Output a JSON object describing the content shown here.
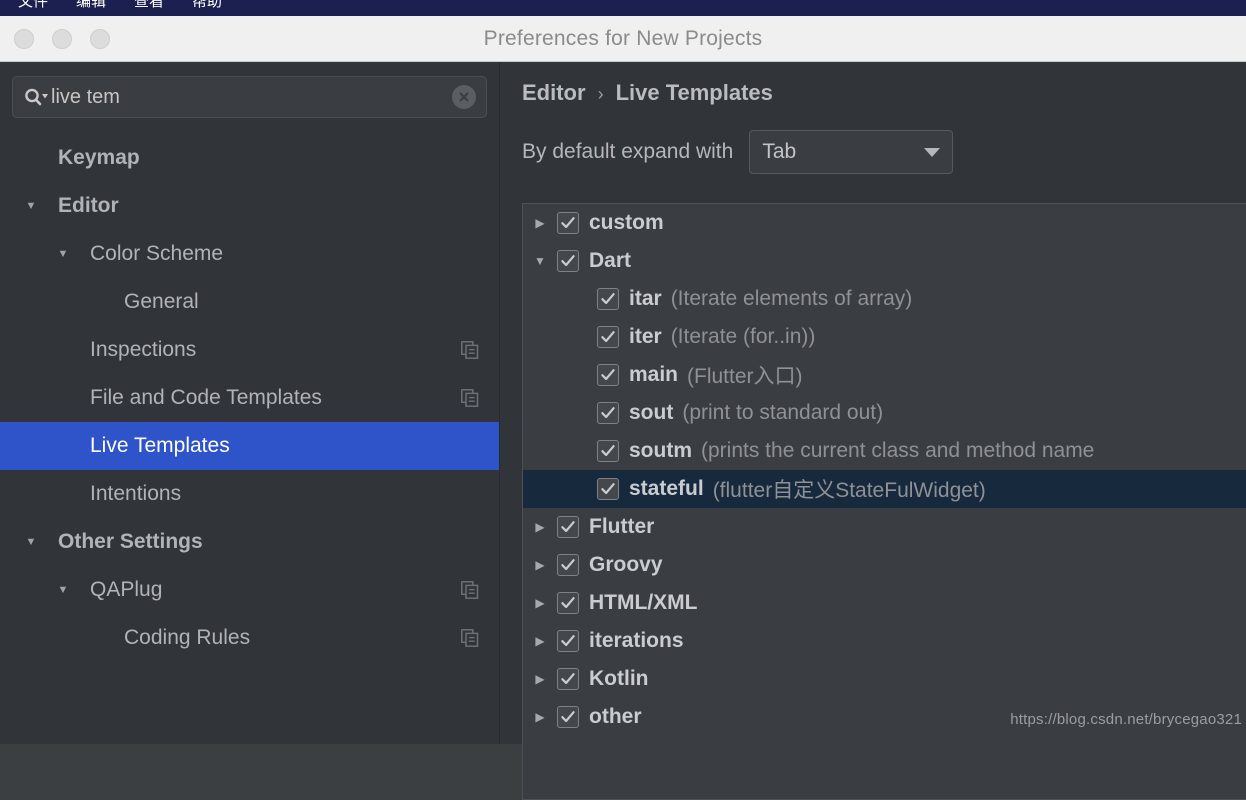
{
  "menubar": {
    "items": [
      "文件",
      "编辑",
      "查看",
      "帮助"
    ]
  },
  "window": {
    "title": "Preferences for New Projects",
    "traffic_lights": [
      "close",
      "minimize",
      "zoom"
    ]
  },
  "sidebar": {
    "search": {
      "value": "live tem",
      "placeholder": "",
      "search_icon": "search-icon",
      "clear_icon": "clear-circle-icon"
    },
    "items": [
      {
        "label": "Keymap",
        "level": 0,
        "twisty": "",
        "bold": true,
        "copy": false,
        "selected": false
      },
      {
        "label": "Editor",
        "level": 0,
        "twisty": "down",
        "bold": true,
        "copy": false,
        "selected": false
      },
      {
        "label": "Color Scheme",
        "level": 1,
        "twisty": "down",
        "bold": false,
        "copy": false,
        "selected": false
      },
      {
        "label": "General",
        "level": 2,
        "twisty": "",
        "bold": false,
        "copy": false,
        "selected": false
      },
      {
        "label": "Inspections",
        "level": 1,
        "twisty": "",
        "bold": false,
        "copy": true,
        "selected": false
      },
      {
        "label": "File and Code Templates",
        "level": 1,
        "twisty": "",
        "bold": false,
        "copy": true,
        "selected": false
      },
      {
        "label": "Live Templates",
        "level": 1,
        "twisty": "",
        "bold": false,
        "copy": false,
        "selected": true
      },
      {
        "label": "Intentions",
        "level": 1,
        "twisty": "",
        "bold": false,
        "copy": false,
        "selected": false
      },
      {
        "label": "Other Settings",
        "level": 0,
        "twisty": "down",
        "bold": true,
        "copy": false,
        "selected": false
      },
      {
        "label": "QAPlug",
        "level": 1,
        "twisty": "down",
        "bold": false,
        "copy": true,
        "selected": false
      },
      {
        "label": "Coding Rules",
        "level": 2,
        "twisty": "",
        "bold": false,
        "copy": true,
        "selected": false
      }
    ]
  },
  "panel": {
    "breadcrumb": {
      "parent": "Editor",
      "separator": "›",
      "current": "Live Templates"
    },
    "expand": {
      "label": "By default expand with",
      "value": "Tab"
    },
    "templates": [
      {
        "name": "custom",
        "desc": "",
        "twisty": "right",
        "level": 0,
        "checked": true,
        "selected": false
      },
      {
        "name": "Dart",
        "desc": "",
        "twisty": "down",
        "level": 0,
        "checked": true,
        "selected": false
      },
      {
        "name": "itar",
        "desc": "(Iterate elements of array)",
        "twisty": "",
        "level": 1,
        "checked": true,
        "selected": false
      },
      {
        "name": "iter",
        "desc": "(Iterate (for..in))",
        "twisty": "",
        "level": 1,
        "checked": true,
        "selected": false
      },
      {
        "name": "main",
        "desc": "(Flutter入口)",
        "twisty": "",
        "level": 1,
        "checked": true,
        "selected": false
      },
      {
        "name": "sout",
        "desc": "(print to standard out)",
        "twisty": "",
        "level": 1,
        "checked": true,
        "selected": false
      },
      {
        "name": "soutm",
        "desc": "(prints the current class and method name",
        "twisty": "",
        "level": 1,
        "checked": true,
        "selected": false
      },
      {
        "name": "stateful",
        "desc": "(flutter自定义StateFulWidget)",
        "twisty": "",
        "level": 1,
        "checked": true,
        "selected": true
      },
      {
        "name": "Flutter",
        "desc": "",
        "twisty": "right",
        "level": 0,
        "checked": true,
        "selected": false
      },
      {
        "name": "Groovy",
        "desc": "",
        "twisty": "right",
        "level": 0,
        "checked": true,
        "selected": false
      },
      {
        "name": "HTML/XML",
        "desc": "",
        "twisty": "right",
        "level": 0,
        "checked": true,
        "selected": false
      },
      {
        "name": "iterations",
        "desc": "",
        "twisty": "right",
        "level": 0,
        "checked": true,
        "selected": false
      },
      {
        "name": "Kotlin",
        "desc": "",
        "twisty": "right",
        "level": 0,
        "checked": true,
        "selected": false
      },
      {
        "name": "other",
        "desc": "",
        "twisty": "right",
        "level": 0,
        "checked": true,
        "selected": false
      }
    ]
  },
  "watermark": "https://blog.csdn.net/brycegao321",
  "colors": {
    "menubar": "#1c2050",
    "titlebar": "#f0f0f0",
    "background": "#313439",
    "selection_blue": "#2f54c9",
    "row_selection_navy": "#16293d",
    "panel_box": "#3a3d42"
  }
}
